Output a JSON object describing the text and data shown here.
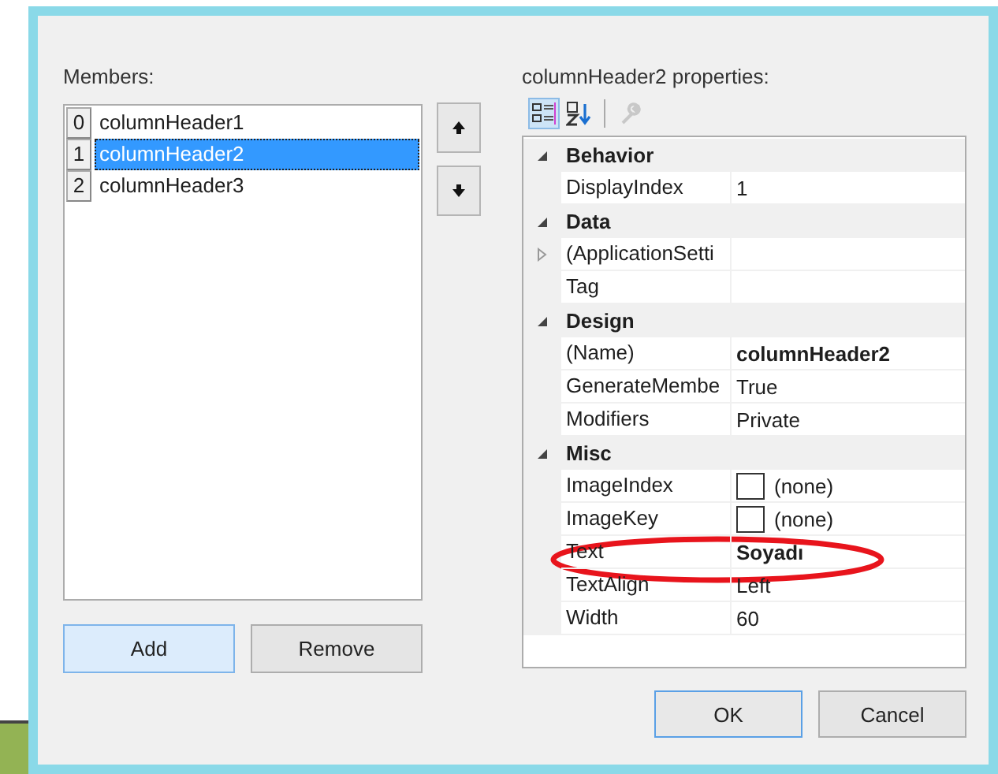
{
  "members_label": "Members:",
  "members": [
    {
      "index": "0",
      "name": "columnHeader1",
      "selected": false
    },
    {
      "index": "1",
      "name": "columnHeader2",
      "selected": true
    },
    {
      "index": "2",
      "name": "columnHeader3",
      "selected": false
    }
  ],
  "properties_label": "columnHeader2 properties:",
  "toolbar": [
    {
      "kind": "categorized",
      "selected": true
    },
    {
      "kind": "alphabetical",
      "selected": false
    },
    {
      "kind": "property-pages",
      "disabled": true
    }
  ],
  "grid": [
    {
      "category": "Behavior",
      "expanded": true,
      "properties": [
        {
          "name": "DisplayIndex",
          "value": "1",
          "bold": false
        }
      ]
    },
    {
      "category": "Data",
      "expanded": true,
      "properties": [
        {
          "name": "(ApplicationSetti",
          "expandable": true
        },
        {
          "name": "Tag"
        }
      ]
    },
    {
      "category": "Design",
      "expanded": true,
      "properties": [
        {
          "name": "(Name)",
          "value": "columnHeader2",
          "bold": true
        },
        {
          "name": "GenerateMembe",
          "value": "True",
          "bold": false
        },
        {
          "name": "Modifiers",
          "value": "Private",
          "bold": false
        }
      ]
    },
    {
      "category": "Misc",
      "expanded": true,
      "properties": [
        {
          "name": "ImageIndex",
          "value": "(none)",
          "kind": "image",
          "bold": false
        },
        {
          "name": "ImageKey",
          "value": "(none)",
          "kind": "image",
          "bold": false
        },
        {
          "name": "Text",
          "value": "Soyadı",
          "bold": true
        },
        {
          "name": "TextAlign",
          "value": "Left",
          "bold": false
        },
        {
          "name": "Width",
          "value": "60",
          "bold": false
        }
      ]
    }
  ],
  "list_buttons": [
    "Add",
    "Remove"
  ],
  "dialog_buttons": [
    "OK",
    "Cancel"
  ]
}
